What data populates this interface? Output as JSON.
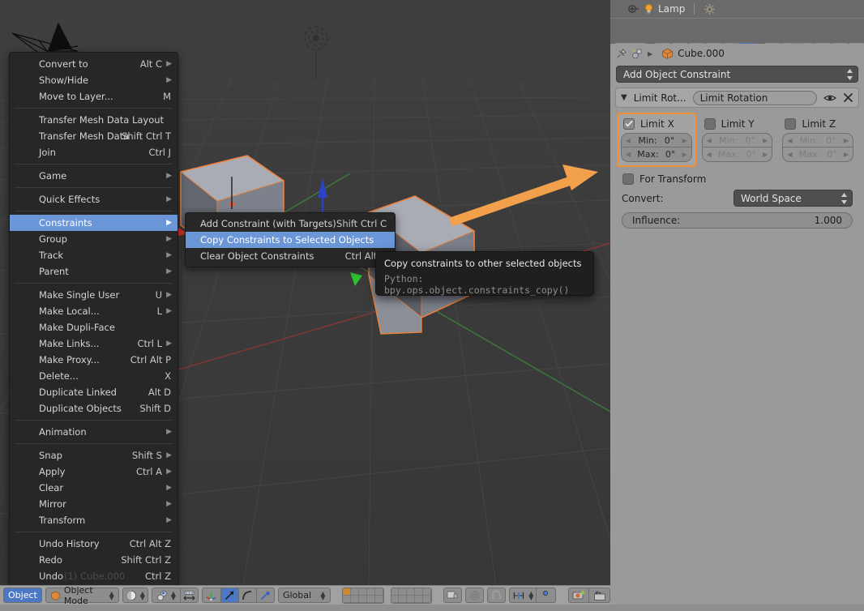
{
  "app": "Blender",
  "viewport": {
    "background_color": "#3b3b3b",
    "grid_color": "#4a4a4a",
    "x_axis_color": "#8c3a3a",
    "y_axis_color": "#3a7a3a",
    "selected_outline_color": "#f0803c",
    "annotation_arrow_color": "#f2a04b",
    "pointer_arrow_color": "#e8352c"
  },
  "menu": {
    "name": "object-menu",
    "groups": [
      {
        "items": [
          {
            "label": "Convert to",
            "shortcut": "Alt C",
            "submenu": true,
            "underline": ""
          },
          {
            "label": "Show/Hide",
            "shortcut": "",
            "submenu": true,
            "underline": "w"
          },
          {
            "label": "Move to Layer...",
            "shortcut": "M",
            "submenu": false,
            "underline": "v"
          }
        ]
      },
      {
        "items": [
          {
            "label": "Transfer Mesh Data Layout",
            "shortcut": "",
            "submenu": false,
            "underline": "y"
          },
          {
            "label": "Transfer Mesh Data",
            "shortcut": "Shift Ctrl T",
            "submenu": false,
            "underline": "M"
          },
          {
            "label": "Join",
            "shortcut": "Ctrl J",
            "submenu": false,
            "underline": "J"
          }
        ]
      },
      {
        "items": [
          {
            "label": "Game",
            "shortcut": "",
            "submenu": true,
            "underline": ""
          }
        ]
      },
      {
        "items": [
          {
            "label": "Quick Effects",
            "shortcut": "",
            "submenu": true,
            "underline": ""
          }
        ]
      },
      {
        "items": [
          {
            "label": "Constraints",
            "shortcut": "",
            "submenu": true,
            "highlighted": true,
            "underline": ""
          },
          {
            "label": "Group",
            "shortcut": "",
            "submenu": true,
            "underline": "G"
          },
          {
            "label": "Track",
            "shortcut": "",
            "submenu": true,
            "underline": ""
          },
          {
            "label": "Parent",
            "shortcut": "",
            "submenu": true,
            "underline": ""
          }
        ]
      },
      {
        "items": [
          {
            "label": "Make Single User",
            "shortcut": "U",
            "submenu": true,
            "underline": "n"
          },
          {
            "label": "Make Local...",
            "shortcut": "L",
            "submenu": true,
            "underline": "c"
          },
          {
            "label": "Make Dupli-Face",
            "shortcut": "",
            "submenu": false,
            "underline": "F"
          },
          {
            "label": "Make Links...",
            "shortcut": "Ctrl L",
            "submenu": true,
            "underline": "e"
          },
          {
            "label": "Make Proxy...",
            "shortcut": "Ctrl Alt P",
            "submenu": false,
            "underline": "P"
          },
          {
            "label": "Delete...",
            "shortcut": "X",
            "submenu": false,
            "underline": "l"
          },
          {
            "label": "Duplicate Linked",
            "shortcut": "Alt D",
            "submenu": false,
            "underline": "L"
          },
          {
            "label": "Duplicate Objects",
            "shortcut": "Shift D",
            "submenu": false,
            "underline": "D"
          }
        ]
      },
      {
        "items": [
          {
            "label": "Animation",
            "shortcut": "",
            "submenu": true,
            "underline": "n"
          }
        ]
      },
      {
        "items": [
          {
            "label": "Snap",
            "shortcut": "Shift S",
            "submenu": true,
            "underline": "S"
          },
          {
            "label": "Apply",
            "shortcut": "Ctrl A",
            "submenu": true,
            "underline": "A"
          },
          {
            "label": "Clear",
            "shortcut": "",
            "submenu": true,
            "underline": "C"
          },
          {
            "label": "Mirror",
            "shortcut": "",
            "submenu": true,
            "underline": "M"
          },
          {
            "label": "Transform",
            "shortcut": "",
            "submenu": true,
            "underline": "T"
          }
        ]
      },
      {
        "items": [
          {
            "label": "Undo History",
            "shortcut": "Ctrl Alt Z",
            "submenu": false,
            "underline": "H"
          },
          {
            "label": "Redo",
            "shortcut": "Shift Ctrl Z",
            "submenu": false,
            "underline": "R"
          },
          {
            "label": "Undo",
            "shortcut": "Ctrl Z",
            "submenu": false,
            "underline": "U"
          }
        ]
      }
    ]
  },
  "submenu": {
    "name": "constraints-submenu",
    "items": [
      {
        "label": "Add Constraint (with Targets)",
        "shortcut": "Shift Ctrl C",
        "highlighted": false
      },
      {
        "label": "Copy Constraints to Selected Objects",
        "shortcut": "",
        "highlighted": true
      },
      {
        "label": "Clear Object Constraints",
        "shortcut": "Ctrl Alt C",
        "highlighted": false
      }
    ]
  },
  "tooltip": {
    "title": "Copy constraints to other selected objects",
    "python": "Python: bpy.ops.object.constraints_copy()"
  },
  "undo_ghost_text": "(1) Cube.000",
  "properties": {
    "lamp_label": "Lamp",
    "breadcrumb_object": "Cube.000",
    "add_constraint_label": "Add Object Constraint",
    "tabs": [
      {
        "name": "render-tab",
        "icon": "camera-icon",
        "active": false
      },
      {
        "name": "render-layers-tab",
        "icon": "images-icon",
        "active": false
      },
      {
        "name": "scene-tab",
        "icon": "scene-icon",
        "active": false
      },
      {
        "name": "world-tab",
        "icon": "globe-icon",
        "active": false
      },
      {
        "name": "object-tab",
        "icon": "cube-icon",
        "active": false
      },
      {
        "name": "constraints-tab",
        "icon": "chain-icon",
        "active": true
      },
      {
        "name": "modifiers-tab",
        "icon": "wrench-icon",
        "active": false
      },
      {
        "name": "data-tab",
        "icon": "triangle-mesh-icon",
        "active": false
      },
      {
        "name": "material-tab",
        "icon": "sphere-icon",
        "active": false
      },
      {
        "name": "texture-tab",
        "icon": "checker-icon",
        "active": false
      },
      {
        "name": "particles-tab",
        "icon": "particles-icon",
        "active": false
      },
      {
        "name": "physics-tab",
        "icon": "physics-icon",
        "active": false
      }
    ],
    "constraint": {
      "type_label": "Limit Rot...",
      "name_value": "Limit Rotation",
      "expand_icon": "chevron-down-icon",
      "visibility_icon": "eye-icon",
      "delete_icon": "x-icon",
      "axes": [
        {
          "axis_label": "Limit X",
          "enabled": true,
          "selected": true,
          "min_label": "Min:",
          "min_value": "0°",
          "max_label": "Max:",
          "max_value": "0°"
        },
        {
          "axis_label": "Limit Y",
          "enabled": false,
          "selected": false,
          "min_label": "Min:",
          "min_value": "0°",
          "max_label": "Max:",
          "max_value": "0°"
        },
        {
          "axis_label": "Limit Z",
          "enabled": false,
          "selected": false,
          "min_label": "Min:",
          "min_value": "0°",
          "max_label": "Max:",
          "max_value": "0°"
        }
      ],
      "for_transform_label": "For Transform",
      "for_transform_enabled": false,
      "convert_label": "Convert:",
      "convert_value": "World Space",
      "influence_label": "Influence:",
      "influence_value": "1.000"
    }
  },
  "viewport_header": {
    "editor_label": "Object",
    "mode_label": "Object Mode",
    "transform_orientation": "Global",
    "viewport_shading_icon": "sphere-shading-icon",
    "pivot_icon": "pivot-icon",
    "manipulator_icons": [
      "translate-manipulator-icon",
      "rotate-manipulator-icon",
      "scale-manipulator-icon"
    ],
    "snap_icon": "magnet-icon",
    "proportional_icon": "proportional-edit-icon",
    "layers_active_index": 0,
    "render_icon": "render-icon",
    "animation_icon": "clapper-icon"
  }
}
